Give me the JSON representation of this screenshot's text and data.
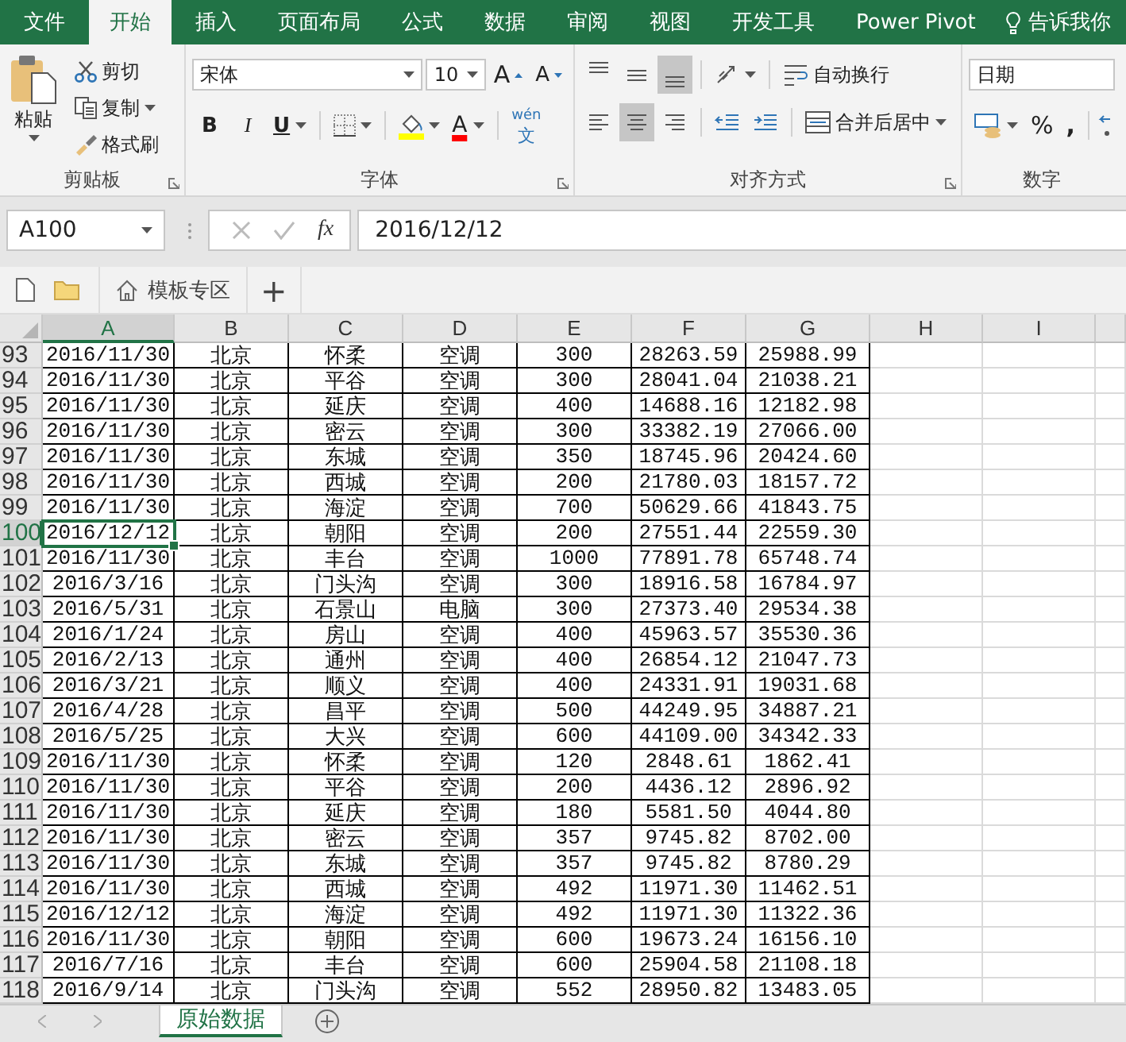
{
  "menu_tabs": [
    {
      "label": "文件",
      "selected": false
    },
    {
      "label": "开始",
      "selected": true
    },
    {
      "label": "插入",
      "selected": false
    },
    {
      "label": "页面布局",
      "selected": false
    },
    {
      "label": "公式",
      "selected": false
    },
    {
      "label": "数据",
      "selected": false
    },
    {
      "label": "审阅",
      "selected": false
    },
    {
      "label": "视图",
      "selected": false
    },
    {
      "label": "开发工具",
      "selected": false
    },
    {
      "label": "Power Pivot",
      "selected": false
    }
  ],
  "tell_me": "告诉我你",
  "clipboard": {
    "paste": "粘贴",
    "cut": "剪切",
    "copy": "复制",
    "format_painter": "格式刷",
    "title": "剪贴板"
  },
  "font": {
    "name": "宋体",
    "size": "10",
    "grow": "A",
    "shrink": "A",
    "bold": "B",
    "italic": "I",
    "underline": "U",
    "font_color_glyph": "A",
    "phonetic": "wén",
    "phonetic_char": "文",
    "title": "字体"
  },
  "alignment": {
    "vertical": [
      {
        "kind": "top",
        "selected": false
      },
      {
        "kind": "middle",
        "selected": false
      },
      {
        "kind": "bottom",
        "selected": true
      }
    ],
    "horizontal": [
      {
        "kind": "left",
        "selected": false
      },
      {
        "kind": "center",
        "selected": true
      },
      {
        "kind": "right",
        "selected": false
      }
    ],
    "wrap_text": "自动换行",
    "merge_center": "合并后居中",
    "title": "对齐方式"
  },
  "number": {
    "format": "日期",
    "percent": "%",
    "comma": ",",
    "title": "数字"
  },
  "formula_bar": {
    "name_box": "A100",
    "function_label": "fx",
    "value": "2016/12/12"
  },
  "doc_tabs": {
    "template": "模板专区",
    "add": "+"
  },
  "sheet": {
    "columns": [
      {
        "label": "A",
        "selected": true
      },
      {
        "label": "B",
        "selected": false
      },
      {
        "label": "C",
        "selected": false
      },
      {
        "label": "D",
        "selected": false
      },
      {
        "label": "E",
        "selected": false
      },
      {
        "label": "F",
        "selected": false
      },
      {
        "label": "G",
        "selected": false
      },
      {
        "label": "H",
        "selected": false
      },
      {
        "label": "I",
        "selected": false
      }
    ],
    "rows": [
      {
        "number": "93",
        "selected": false,
        "cells": [
          "2016/11/30",
          "北京",
          "怀柔",
          "空调",
          "300",
          "28263.59",
          "25988.99"
        ]
      },
      {
        "number": "94",
        "selected": false,
        "cells": [
          "2016/11/30",
          "北京",
          "平谷",
          "空调",
          "300",
          "28041.04",
          "21038.21"
        ]
      },
      {
        "number": "95",
        "selected": false,
        "cells": [
          "2016/11/30",
          "北京",
          "延庆",
          "空调",
          "400",
          "14688.16",
          "12182.98"
        ]
      },
      {
        "number": "96",
        "selected": false,
        "cells": [
          "2016/11/30",
          "北京",
          "密云",
          "空调",
          "300",
          "33382.19",
          "27066.00"
        ]
      },
      {
        "number": "97",
        "selected": false,
        "cells": [
          "2016/11/30",
          "北京",
          "东城",
          "空调",
          "350",
          "18745.96",
          "20424.60"
        ]
      },
      {
        "number": "98",
        "selected": false,
        "cells": [
          "2016/11/30",
          "北京",
          "西城",
          "空调",
          "200",
          "21780.03",
          "18157.72"
        ]
      },
      {
        "number": "99",
        "selected": false,
        "cells": [
          "2016/11/30",
          "北京",
          "海淀",
          "空调",
          "700",
          "50629.66",
          "41843.75"
        ]
      },
      {
        "number": "100",
        "selected": true,
        "cells": [
          "2016/12/12",
          "北京",
          "朝阳",
          "空调",
          "200",
          "27551.44",
          "22559.30"
        ]
      },
      {
        "number": "101",
        "selected": false,
        "cells": [
          "2016/11/30",
          "北京",
          "丰台",
          "空调",
          "1000",
          "77891.78",
          "65748.74"
        ]
      },
      {
        "number": "102",
        "selected": false,
        "cells": [
          "2016/3/16",
          "北京",
          "门头沟",
          "空调",
          "300",
          "18916.58",
          "16784.97"
        ]
      },
      {
        "number": "103",
        "selected": false,
        "cells": [
          "2016/5/31",
          "北京",
          "石景山",
          "电脑",
          "300",
          "27373.40",
          "29534.38"
        ]
      },
      {
        "number": "104",
        "selected": false,
        "cells": [
          "2016/1/24",
          "北京",
          "房山",
          "空调",
          "400",
          "45963.57",
          "35530.36"
        ]
      },
      {
        "number": "105",
        "selected": false,
        "cells": [
          "2016/2/13",
          "北京",
          "通州",
          "空调",
          "400",
          "26854.12",
          "21047.73"
        ]
      },
      {
        "number": "106",
        "selected": false,
        "cells": [
          "2016/3/21",
          "北京",
          "顺义",
          "空调",
          "400",
          "24331.91",
          "19031.68"
        ]
      },
      {
        "number": "107",
        "selected": false,
        "cells": [
          "2016/4/28",
          "北京",
          "昌平",
          "空调",
          "500",
          "44249.95",
          "34887.21"
        ]
      },
      {
        "number": "108",
        "selected": false,
        "cells": [
          "2016/5/25",
          "北京",
          "大兴",
          "空调",
          "600",
          "44109.00",
          "34342.33"
        ]
      },
      {
        "number": "109",
        "selected": false,
        "cells": [
          "2016/11/30",
          "北京",
          "怀柔",
          "空调",
          "120",
          "2848.61",
          "1862.41"
        ]
      },
      {
        "number": "110",
        "selected": false,
        "cells": [
          "2016/11/30",
          "北京",
          "平谷",
          "空调",
          "200",
          "4436.12",
          "2896.92"
        ]
      },
      {
        "number": "111",
        "selected": false,
        "cells": [
          "2016/11/30",
          "北京",
          "延庆",
          "空调",
          "180",
          "5581.50",
          "4044.80"
        ]
      },
      {
        "number": "112",
        "selected": false,
        "cells": [
          "2016/11/30",
          "北京",
          "密云",
          "空调",
          "357",
          "9745.82",
          "8702.00"
        ]
      },
      {
        "number": "113",
        "selected": false,
        "cells": [
          "2016/11/30",
          "北京",
          "东城",
          "空调",
          "357",
          "9745.82",
          "8780.29"
        ]
      },
      {
        "number": "114",
        "selected": false,
        "cells": [
          "2016/11/30",
          "北京",
          "西城",
          "空调",
          "492",
          "11971.30",
          "11462.51"
        ]
      },
      {
        "number": "115",
        "selected": false,
        "cells": [
          "2016/12/12",
          "北京",
          "海淀",
          "空调",
          "492",
          "11971.30",
          "11322.36"
        ]
      },
      {
        "number": "116",
        "selected": false,
        "cells": [
          "2016/11/30",
          "北京",
          "朝阳",
          "空调",
          "600",
          "19673.24",
          "16156.10"
        ]
      },
      {
        "number": "117",
        "selected": false,
        "cells": [
          "2016/7/16",
          "北京",
          "丰台",
          "空调",
          "600",
          "25904.58",
          "21108.18"
        ]
      },
      {
        "number": "118",
        "selected": false,
        "cells": [
          "2016/9/14",
          "北京",
          "门头沟",
          "空调",
          "552",
          "28950.82",
          "13483.05"
        ]
      }
    ]
  },
  "sheet_tabs": [
    {
      "label": "原始数据",
      "selected": true
    }
  ]
}
